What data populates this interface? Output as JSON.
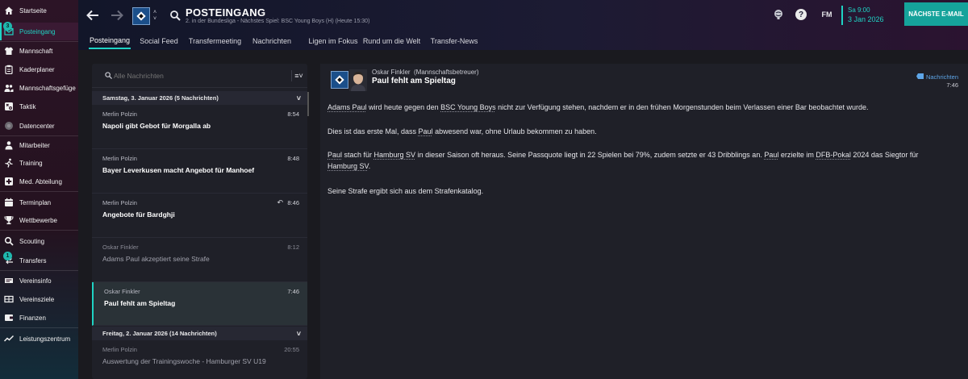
{
  "sidebar": {
    "items": [
      {
        "label": "Startseite",
        "icon": "home-icon"
      },
      {
        "label": "Posteingang",
        "icon": "inbox-icon",
        "badge": "3",
        "active": true
      },
      {
        "label": "Mannschaft",
        "icon": "shirt-icon"
      },
      {
        "label": "Kaderplaner",
        "icon": "clipboard-icon"
      },
      {
        "label": "Mannschaftsgefüge",
        "icon": "users-icon"
      },
      {
        "label": "Taktik",
        "icon": "tactics-icon"
      },
      {
        "label": "Datencenter",
        "icon": "chart-icon"
      },
      {
        "label": "Mitarbeiter",
        "icon": "staff-icon"
      },
      {
        "label": "Training",
        "icon": "training-icon"
      },
      {
        "label": "Med. Abteilung",
        "icon": "medical-icon"
      },
      {
        "label": "Terminplan",
        "icon": "calendar-icon"
      },
      {
        "label": "Wettbewerbe",
        "icon": "trophy-icon"
      },
      {
        "label": "Scouting",
        "icon": "scouting-icon"
      },
      {
        "label": "Transfers",
        "icon": "transfers-icon",
        "badge": "1"
      },
      {
        "label": "Vereinsinfo",
        "icon": "club-info-icon"
      },
      {
        "label": "Vereinsziele",
        "icon": "goals-icon"
      },
      {
        "label": "Finanzen",
        "icon": "finance-icon"
      },
      {
        "label": "Leistungszentrum",
        "icon": "performance-icon"
      }
    ]
  },
  "header": {
    "title": "POSTEINGANG",
    "subtitle": "2. in der Bundesliga - Nächstes Spiel: BSC Young Boys (H) (Heute 15:30)",
    "date_day": "Sa 9:00",
    "date": "3 Jan 2026",
    "fm_label": "FM",
    "next_button": "NÄCHSTE E-MAIL",
    "help_label": "?"
  },
  "tabs": [
    "Posteingang",
    "Social Feed",
    "Transfermeeting",
    "Nachrichten",
    "Ligen im Fokus",
    "Rund um die Welt",
    "Transfer-News"
  ],
  "inbox": {
    "search_placeholder": "Alle Nachrichten",
    "groups": [
      {
        "label": "Samstag, 3. Januar 2026 (5 Nachrichten)"
      },
      {
        "label": "Freitag, 2. Januar 2026 (14 Nachrichten)"
      }
    ],
    "messages": [
      {
        "sender": "Merlin Polzin",
        "time": "8:54",
        "subject": "Napoli gibt Gebot für Morgalla ab"
      },
      {
        "sender": "Merlin Polzin",
        "time": "8:48",
        "subject": "Bayer Leverkusen macht Angebot für Manhoef"
      },
      {
        "sender": "Merlin Polzin",
        "time": "8:46",
        "subject": "Angebote für Bardghji"
      },
      {
        "sender": "Oskar Finkler",
        "time": "8:12",
        "subject": "Adams Paul akzeptiert seine Strafe"
      },
      {
        "sender": "Oskar Finkler",
        "time": "7:46",
        "subject": "Paul fehlt am Spieltag"
      },
      {
        "sender": "Merlin Polzin",
        "time": "20:55",
        "subject": "Auswertung der Trainingswoche - Hamburger SV U19"
      }
    ]
  },
  "detail": {
    "sender": "Oskar Finkler",
    "sender_role": "(Mannschaftsbetreuer)",
    "subject": "Paul fehlt am Spieltag",
    "category": "Nachrichten",
    "time": "7:46",
    "p1": {
      "a": "Adams Paul",
      "b": " wird heute gegen den ",
      "c": "BSC Young Boys",
      "d": " nicht zur Verfügung stehen, nachdem er in den frühen Morgenstunden beim Verlassen einer Bar beobachtet wurde."
    },
    "p2": {
      "a": "Dies ist das erste Mal, dass ",
      "b": "Paul",
      "c": " abwesend war, ohne Urlaub bekommen zu haben."
    },
    "p3": {
      "a": "Paul",
      "b": " stach für ",
      "c": "Hamburg SV",
      "d": " in dieser Saison oft heraus. Seine Passquote liegt in 22 Spielen bei 79%, zudem setzte er 43 Dribblings an. ",
      "e": "Paul",
      "f": " erzielte im ",
      "g": "DFB-Pokal",
      "h": " 2024 das Siegtor für",
      "i": "Hamburg SV",
      "j": "."
    },
    "p4": "Seine Strafe ergibt sich aus dem Strafenkatalog."
  },
  "colors": {
    "accent": "#1fd3c4",
    "button": "#15a39b",
    "sidebar": "#2c1426"
  }
}
